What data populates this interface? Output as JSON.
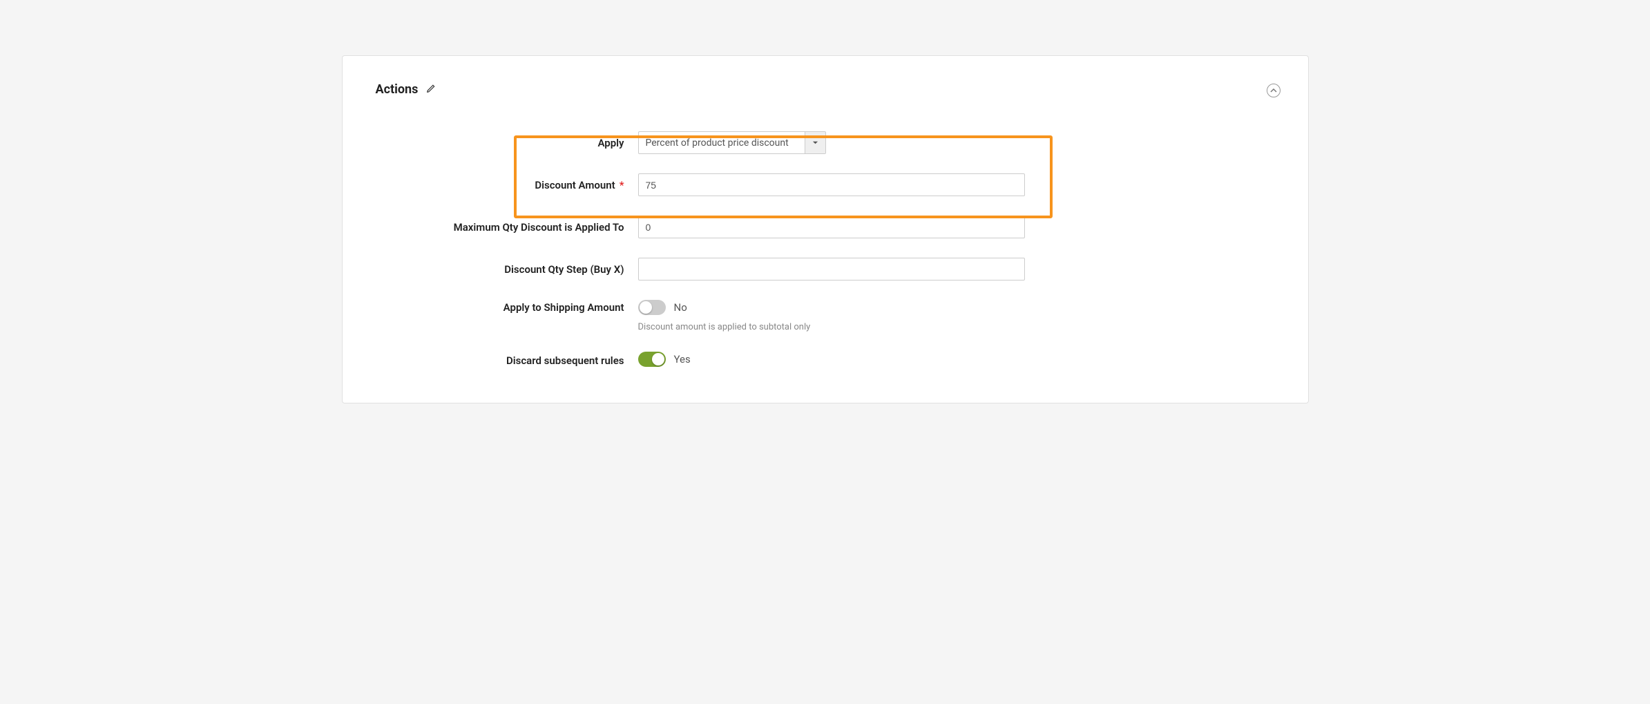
{
  "panel": {
    "title": "Actions"
  },
  "fields": {
    "apply": {
      "label": "Apply",
      "value": "Percent of product price discount"
    },
    "discount_amount": {
      "label": "Discount Amount",
      "value": "75",
      "required": true
    },
    "max_qty": {
      "label": "Maximum Qty Discount is Applied To",
      "value": "0"
    },
    "qty_step": {
      "label": "Discount Qty Step (Buy X)",
      "value": ""
    },
    "apply_shipping": {
      "label": "Apply to Shipping Amount",
      "value_label": "No",
      "help": "Discount amount is applied to subtotal only"
    },
    "discard_subsequent": {
      "label": "Discard subsequent rules",
      "value_label": "Yes"
    }
  }
}
